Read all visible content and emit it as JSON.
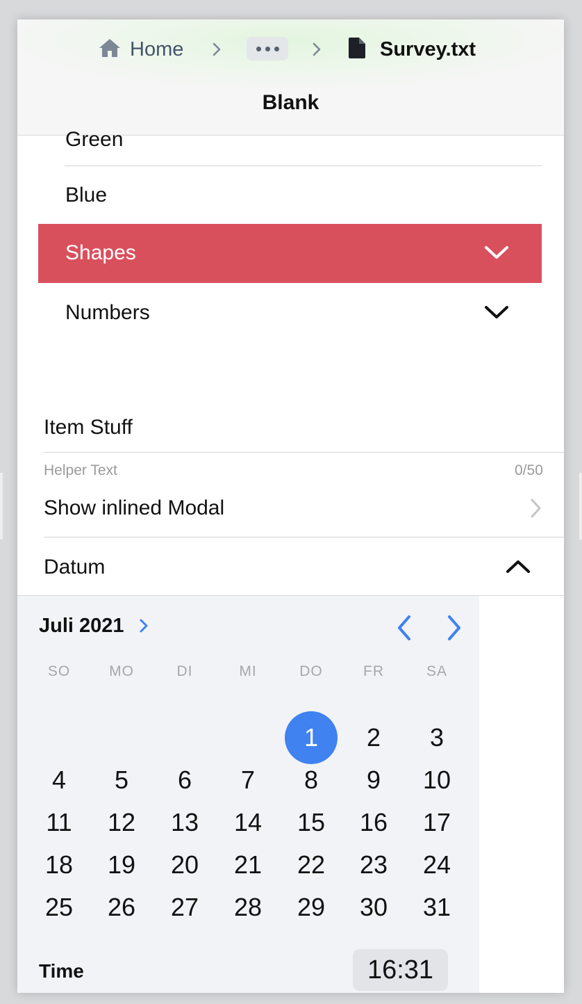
{
  "breadcrumb": {
    "home_label": "Home",
    "home_icon": "home-icon",
    "ellipsis_icon": "more-horizontal-icon",
    "file_label": "Survey.txt",
    "file_icon": "document-icon"
  },
  "header": {
    "title": "Blank"
  },
  "list": {
    "partial_item": "Green",
    "blue_item": "Blue",
    "shapes_item": "Shapes",
    "numbers_item": "Numbers"
  },
  "form": {
    "item_label": "Item Stuff",
    "helper_text": "Helper Text",
    "counter": "0/50",
    "modal_label": "Show inlined Modal",
    "datum_label": "Datum"
  },
  "calendar": {
    "month_label": "Juli 2021",
    "weekdays": [
      "SO",
      "MO",
      "DI",
      "MI",
      "DO",
      "FR",
      "SA"
    ],
    "days": [
      "1",
      "2",
      "3",
      "4",
      "5",
      "6",
      "7",
      "8",
      "9",
      "10",
      "11",
      "12",
      "13",
      "14",
      "15",
      "16",
      "17",
      "18",
      "19",
      "20",
      "21",
      "22",
      "23",
      "24",
      "25",
      "26",
      "27",
      "28",
      "29",
      "30",
      "31"
    ],
    "selected_day": "1",
    "time_label": "Time",
    "time_value": "16:31"
  },
  "colors": {
    "selected_row": "#d9505d",
    "accent": "#3f82f0",
    "calendar_bg": "#f2f3f7"
  }
}
